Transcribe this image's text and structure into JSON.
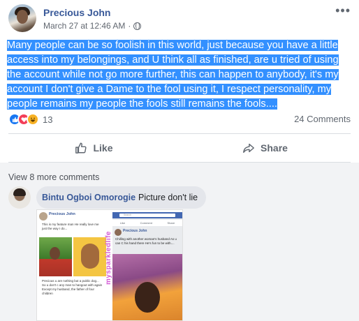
{
  "post": {
    "author": "Precious John",
    "date": "March 27 at 12:46 AM",
    "privacy_icon": "globe-icon",
    "more_icon": "ellipsis-icon",
    "text": "Many people can be so foolish in this world, just because you have a little access into my belongings, and U think all as finished, are u tried of using the account while not go more further, this can happen to anybody, it's my account I don't give a Dame to the fool using it, I respect personality, my people remains my people the fools still remains the fools....",
    "text_highlight_color": "#3390ff",
    "reaction_count": "13",
    "comment_count": "24 Comments"
  },
  "actions": {
    "like_label": "Like",
    "share_label": "Share"
  },
  "comments": {
    "view_more": "View 8 more comments",
    "items": [
      {
        "author": "Bintu Ogboi Omorogie",
        "text": "Picture don't lie"
      }
    ]
  },
  "attached_photo": {
    "left_post": {
      "author": "Precious John",
      "caption": "This is my feature man He really love me just the way I do...",
      "comment": "Precious u are nothing but a public dog... So u don't c any man to hangout with again Except my husband, the father of four children"
    },
    "right_post": {
      "search_placeholder": "Search",
      "author": "Precious John",
      "caption": "Chilling with another woman's husband As u can C his hand there He's fun to be with....",
      "like": "Like",
      "comment": "Comment",
      "share": "Share"
    },
    "watermark": "mysparkledlife"
  },
  "colors": {
    "brand_link": "#385898",
    "like": "#1877f2",
    "love": "#f33e58",
    "haha": "#f7b125"
  }
}
